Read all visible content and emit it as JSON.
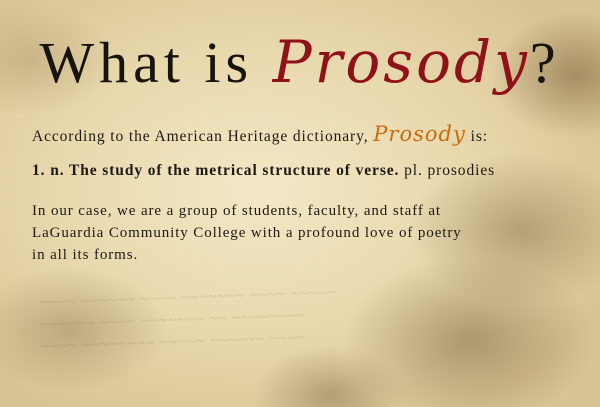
{
  "heading": {
    "prefix": "What is",
    "accent": "Prosody",
    "suffix": "?"
  },
  "definition_intro": {
    "before": "According to the American Heritage dictionary,",
    "accent": "Prosody",
    "after": "is:"
  },
  "definition": {
    "bold": "1. n. The study of the metrical structure of verse.",
    "plain": "pl. prosodies"
  },
  "description": {
    "lines": [
      "In our case, we are a group of students, faculty, and staff at",
      "LaGuardia Community College with a profound love of poetry",
      "in all its forms."
    ]
  },
  "colors": {
    "title_accent": "#8e1218",
    "inline_accent": "#c96b0e",
    "text": "#1e1a14",
    "parchment": "#e8d8ad"
  }
}
